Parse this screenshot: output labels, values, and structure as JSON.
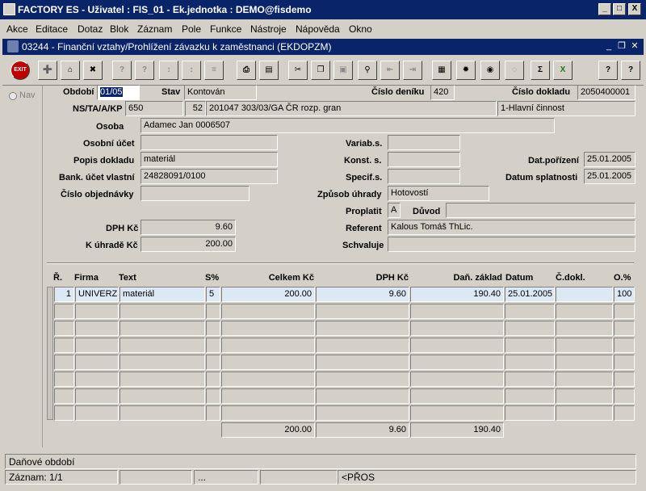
{
  "app": {
    "title": "FACTORY ES - Uživatel : FIS_01 - Ek.jednotka : DEMO@fisdemo",
    "win_min": "_",
    "win_max": "□",
    "win_close": "X"
  },
  "menu": [
    "Akce",
    "Editace",
    "Dotaz",
    "Blok",
    "Záznam",
    "Pole",
    "Funkce",
    "Nástroje",
    "Nápověda",
    "Okno"
  ],
  "child": {
    "title": "03244 - Finanční vztahy/Prohlížení závazku k zaměstnanci (EKDOPZM)",
    "min": "_",
    "restore": "❐",
    "close": "✕"
  },
  "toolbar": {
    "exit_label": "EXIT",
    "sum_label": "Σ",
    "help_label": "?",
    "icons": [
      "exit-icon",
      "add-record-icon",
      "save-record-icon",
      "delete-record-icon",
      "query-icon",
      "execute-query-icon",
      "sort-asc-icon",
      "sort-desc-icon",
      "list-icon",
      "print-icon",
      "print-preview-icon",
      "cut-icon",
      "copy-icon",
      "paste-icon",
      "zoom-icon",
      "first-icon",
      "last-icon",
      "calculator-icon",
      "wheel-icon",
      "eye-icon",
      "calendar-icon",
      "sum-icon",
      "excel-icon",
      "help-icon",
      "context-help-icon"
    ]
  },
  "nav": {
    "label": "Nav"
  },
  "form": {
    "obdobi_label": "Období",
    "obdobi_value": "01/05",
    "stav_label": "Stav",
    "stav_value": "Kontován",
    "cislo_deniku_label": "Číslo deníku",
    "cislo_deniku_value": "420",
    "cislo_dokladu_label": "Číslo dokladu",
    "cislo_dokladu_value": "2050400001",
    "ns_label": "NS/TA/A/KP",
    "ns_value": "650",
    "ta_value": "52",
    "a_value": "201047 303/03/GA ČR rozp. gran",
    "kp_value": "1-Hlavní činnost",
    "osoba_label": "Osoba",
    "osoba_value": "Adamec Jan 0006507",
    "osobni_ucet_label": "Osobní účet",
    "osobni_ucet_value": "",
    "variab_label": "Variab.s.",
    "variab_value": "",
    "popis_label": "Popis dokladu",
    "popis_value": "materiál",
    "konst_label": "Konst. s.",
    "konst_value": "",
    "dat_porizeni_label": "Dat.pořízení",
    "dat_porizeni_value": "25.01.2005",
    "bank_label": "Bank. účet vlastní",
    "bank_value": "24828091/0100",
    "specif_label": "Specif.s.",
    "specif_value": "",
    "datum_splatnosti_label": "Datum splatnosti",
    "datum_splatnosti_value": "25.01.2005",
    "cislo_obj_label": "Číslo objednávky",
    "cislo_obj_value": "",
    "zpusob_label": "Způsob úhrady",
    "zpusob_value": "Hotovostí",
    "proplatit_label": "Proplatit",
    "proplatit_value": "A",
    "duvod_label": "Důvod",
    "duvod_value": "",
    "dph_label": "DPH Kč",
    "dph_value": "9.60",
    "referent_label": "Referent",
    "referent_value": "Kalous Tomáš ThLic.",
    "k_uhrade_label": "K úhradě Kč",
    "k_uhrade_value": "200.00",
    "schvaluje_label": "Schvaluje",
    "schvaluje_value": ""
  },
  "grid": {
    "headers": {
      "r": "Ř.",
      "firma": "Firma",
      "text": "Text",
      "s": "S%",
      "celkem": "Celkem Kč",
      "dph": "DPH Kč",
      "zaklad": "Daň. základ",
      "datum": "Datum",
      "cdokl": "Č.dokl.",
      "o": "O.%"
    },
    "rows": [
      {
        "r": "1",
        "firma": "UNIVERZIT",
        "text": "materiál",
        "s": "5",
        "celkem": "200.00",
        "dph": "9.60",
        "zaklad": "190.40",
        "datum": "25.01.2005",
        "cdokl": "",
        "o": "100"
      }
    ],
    "totals": {
      "celkem": "200.00",
      "dph": "9.60",
      "zaklad": "190.40"
    }
  },
  "status": {
    "hint": "Daňové období",
    "record": "Záznam: 1/1",
    "dots": "...",
    "mode": "<PŘOS"
  }
}
